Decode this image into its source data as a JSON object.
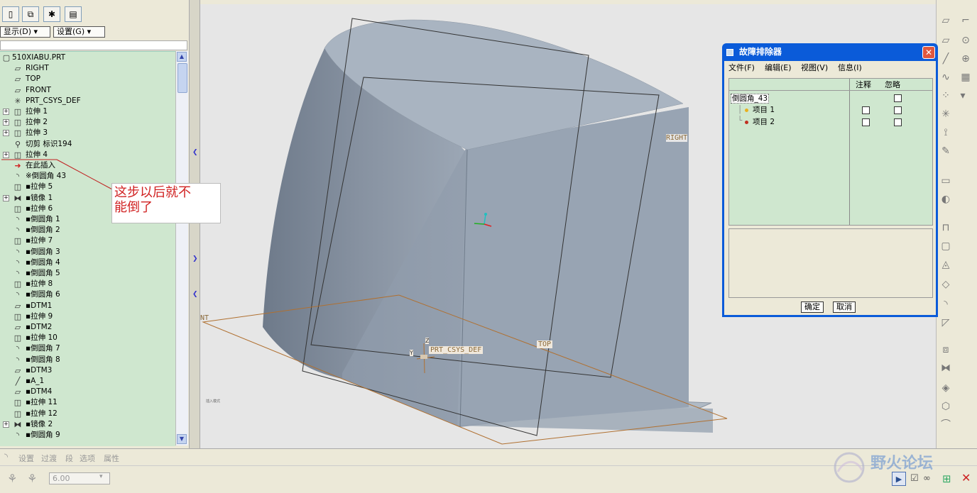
{
  "sidebar": {
    "tabs": [
      "model-tree-icon",
      "layers-icon",
      "favorites-icon",
      "folder-browser-icon"
    ],
    "display_menu": "显示(D) ▾",
    "settings_menu": "设置(G) ▾",
    "tree_items": [
      {
        "label": "510XIABU.PRT",
        "icon": "part-icon",
        "expand": false,
        "root": true
      },
      {
        "label": "RIGHT",
        "icon": "datum-plane-icon",
        "expand": false
      },
      {
        "label": "TOP",
        "icon": "datum-plane-icon",
        "expand": false
      },
      {
        "label": "FRONT",
        "icon": "datum-plane-icon",
        "expand": false
      },
      {
        "label": "PRT_CSYS_DEF",
        "icon": "csys-icon",
        "expand": false
      },
      {
        "label": "拉伸 1",
        "icon": "extrude-icon",
        "expand": true
      },
      {
        "label": "拉伸 2",
        "icon": "extrude-icon",
        "expand": true
      },
      {
        "label": "拉伸 3",
        "icon": "extrude-icon",
        "expand": true
      },
      {
        "label": "切剪 标识194",
        "icon": "cut-icon",
        "expand": false
      },
      {
        "label": "拉伸 4",
        "icon": "extrude-icon",
        "expand": true
      },
      {
        "label": "在此插入",
        "icon": "insert-arrow-icon",
        "expand": false
      },
      {
        "label": "※倒圆角 43",
        "icon": "round-icon",
        "expand": false
      },
      {
        "label": "▪拉伸 5",
        "icon": "extrude-icon",
        "expand": false
      },
      {
        "label": "▪镜像 1",
        "icon": "mirror-icon",
        "expand": true
      },
      {
        "label": "▪拉伸 6",
        "icon": "extrude-icon",
        "expand": false
      },
      {
        "label": "▪倒圆角 1",
        "icon": "round-icon",
        "expand": false
      },
      {
        "label": "▪倒圆角 2",
        "icon": "round-icon",
        "expand": false
      },
      {
        "label": "▪拉伸 7",
        "icon": "extrude-icon",
        "expand": false
      },
      {
        "label": "▪倒圆角 3",
        "icon": "round-icon",
        "expand": false
      },
      {
        "label": "▪倒圆角 4",
        "icon": "round-icon",
        "expand": false
      },
      {
        "label": "▪倒圆角 5",
        "icon": "round-icon",
        "expand": false
      },
      {
        "label": "▪拉伸 8",
        "icon": "extrude-icon",
        "expand": false
      },
      {
        "label": "▪倒圆角 6",
        "icon": "round-icon",
        "expand": false
      },
      {
        "label": "▪DTM1",
        "icon": "datum-plane-icon",
        "expand": false
      },
      {
        "label": "▪拉伸 9",
        "icon": "extrude-icon",
        "expand": false
      },
      {
        "label": "▪DTM2",
        "icon": "datum-plane-icon",
        "expand": false
      },
      {
        "label": "▪拉伸 10",
        "icon": "extrude-icon",
        "expand": false
      },
      {
        "label": "▪倒圆角 7",
        "icon": "round-icon",
        "expand": false
      },
      {
        "label": "▪倒圆角 8",
        "icon": "round-icon",
        "expand": false
      },
      {
        "label": "▪DTM3",
        "icon": "datum-plane-icon",
        "expand": false
      },
      {
        "label": "▪A_1",
        "icon": "axis-icon",
        "expand": false
      },
      {
        "label": "▪DTM4",
        "icon": "datum-plane-icon",
        "expand": false
      },
      {
        "label": "▪拉伸 11",
        "icon": "extrude-icon",
        "expand": false
      },
      {
        "label": "▪拉伸 12",
        "icon": "extrude-icon",
        "expand": false
      },
      {
        "label": "▪镜像 2",
        "icon": "mirror-icon",
        "expand": true
      },
      {
        "label": "▪倒圆角 9",
        "icon": "round-icon",
        "expand": false
      }
    ]
  },
  "annotation": {
    "line1": "这步以后就不",
    "line2": "能倒了"
  },
  "viewport": {
    "datum_labels": {
      "right": "RIGHT",
      "top": "TOP",
      "front": "NT",
      "csys": "PRT_CSYS_DEF",
      "csys_z": "Z",
      "csys_y": "Y"
    },
    "tiny_text": "插入模式"
  },
  "dialog": {
    "title": "故障排除器",
    "menus": [
      "文件(F)",
      "编辑(E)",
      "视图(V)",
      "信息(I)"
    ],
    "col_note": "注释",
    "col_ignore": "忽略",
    "rows": [
      {
        "label": "倒圆角_43",
        "note_box": false,
        "ignore_box": true
      },
      {
        "label": "项目 1",
        "note_box": true,
        "ignore_box": true,
        "dot": "#e8b020"
      },
      {
        "label": "项目 2",
        "note_box": true,
        "ignore_box": true,
        "dot": "#c03020"
      }
    ],
    "ok": "确定",
    "cancel": "取消"
  },
  "bottom": {
    "tabs": [
      "设置",
      "过渡",
      "段",
      "选项",
      "属性"
    ],
    "radius_value": "6.00",
    "watermark": "野火论坛"
  },
  "colors": {
    "tree_bg": "#cfe7cf",
    "part_face": "#9aa6b4",
    "dialog_title": "#0a5bd9",
    "annotation_text": "#d02020"
  }
}
